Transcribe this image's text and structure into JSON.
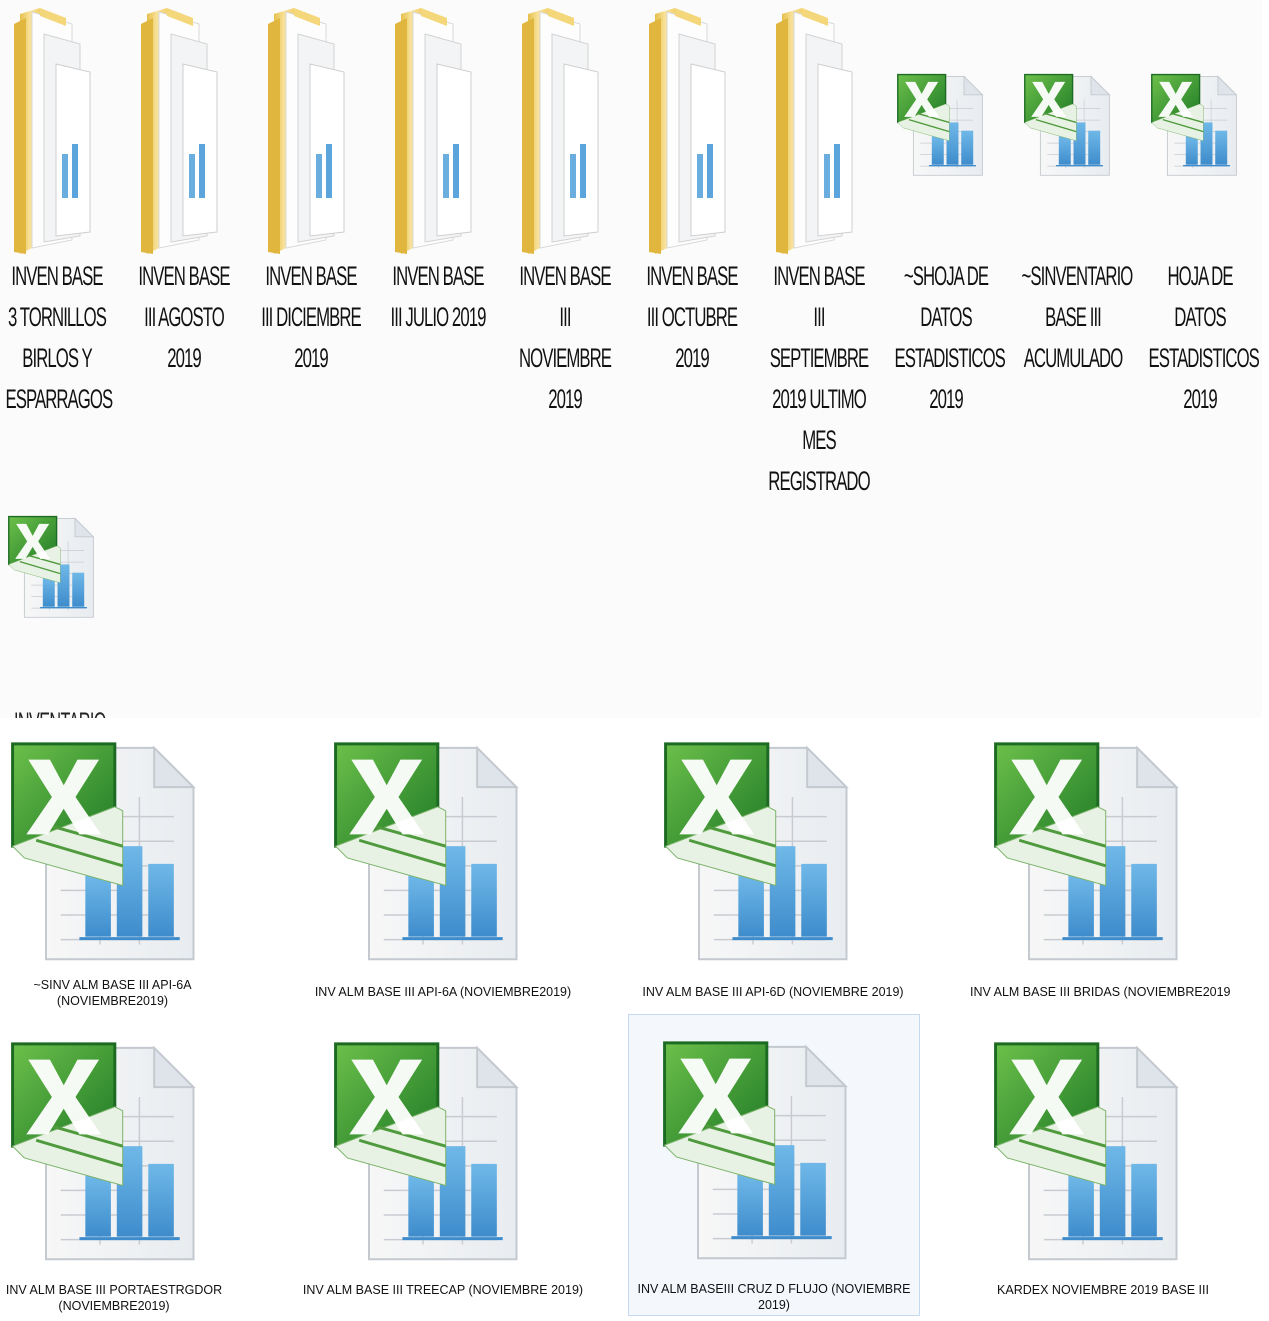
{
  "top_items": [
    {
      "kind": "folder",
      "label": "INVEN BASE 3 TORNILLOS BIRLOS Y ESPARRAGOS"
    },
    {
      "kind": "folder",
      "label": "INVEN BASE III AGOSTO 2019"
    },
    {
      "kind": "folder",
      "label": "INVEN BASE III DICIEMBRE 2019"
    },
    {
      "kind": "folder",
      "label": "INVEN BASE III JULIO 2019"
    },
    {
      "kind": "folder",
      "label": "INVEN BASE III NOVIEMBRE 2019"
    },
    {
      "kind": "folder",
      "label": "INVEN BASE III OCTUBRE 2019"
    },
    {
      "kind": "folder",
      "label": "INVEN BASE III SEPTIEMBRE 2019 ULTIMO MES REGISTRADO"
    },
    {
      "kind": "excel",
      "label": "~SHOJA DE DATOS ESTADISTICOS 2019"
    },
    {
      "kind": "excel",
      "label": "~SINVENTARIO BASE III ACUMULADO"
    },
    {
      "kind": "excel",
      "label": "HOJA DE DATOS ESTADISTICOS 2019"
    },
    {
      "kind": "excel",
      "label": "INVENTARIO"
    }
  ],
  "bottom_items": [
    {
      "label": "~SINV ALM BASE III API-6A (NOVIEMBRE2019)"
    },
    {
      "label": "INV ALM BASE III API-6A (NOVIEMBRE2019)"
    },
    {
      "label": "INV ALM BASE III API-6D (NOVIEMBRE 2019)"
    },
    {
      "label": "INV ALM BASE III BRIDAS (NOVIEMBRE2019)"
    },
    {
      "label": "INV ALM BASE III PORTAESTRGDOR (NOVIEMBRE2019)"
    },
    {
      "label": "INV ALM BASE III TREECAP (NOVIEMBRE 2019)"
    },
    {
      "label": "INV ALM BASEIII CRUZ D FLUJO (NOVIEMBRE 2019)",
      "selected": true
    },
    {
      "label": "KARDEX NOVIEMBRE 2019 BASE III"
    }
  ],
  "colors": {
    "folder": "#f4d77a",
    "excel_green": "#2e8b2e",
    "chart_blue": "#5aa7de",
    "selection": "#c5daf2"
  }
}
